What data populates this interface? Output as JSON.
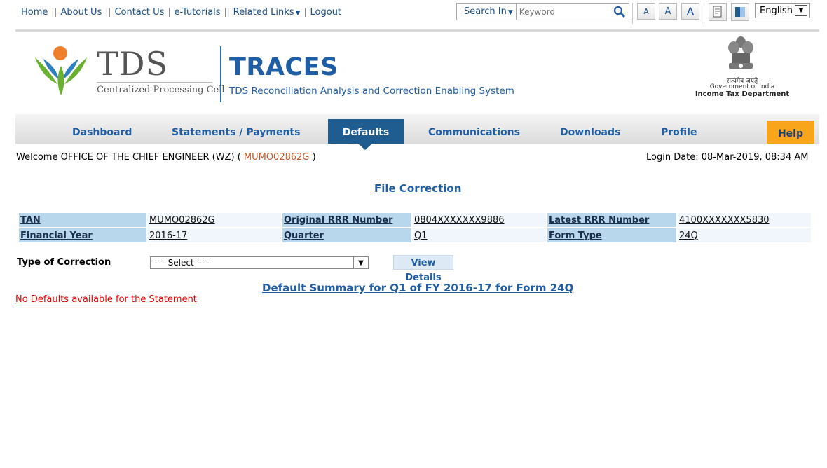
{
  "topbar": {
    "links": [
      "Home",
      "About Us",
      "Contact Us",
      "e-Tutorials",
      "Related Links",
      "Logout"
    ],
    "search_in_label": "Search In",
    "search_placeholder": "Keyword",
    "font_sizes": [
      "A",
      "A",
      "A"
    ],
    "language": "English"
  },
  "header": {
    "tds_logo_text": "TDS",
    "tds_subtitle": "Centralized Processing Cell",
    "app_name": "TRACES",
    "app_fullname": "TDS Reconciliation Analysis and Correction Enabling System",
    "gov_motto": "सत्यमेव जयते",
    "gov_line": "Government of India",
    "dept": "Income Tax Department"
  },
  "nav": {
    "items": [
      "Dashboard",
      "Statements / Payments",
      "Defaults",
      "Communications",
      "Downloads",
      "Profile"
    ],
    "active": "Defaults",
    "help": "Help"
  },
  "welcome": {
    "prefix": "Welcome OFFICE OF THE CHIEF ENGINEER (WZ) (",
    "tan": "MUMO02862G",
    "suffix": ")",
    "login_date": "Login Date: 08-Mar-2019, 08:34 AM"
  },
  "page": {
    "title": "File Correction",
    "info": {
      "tan_label": "TAN",
      "tan": "MUMO02862G",
      "orig_rrr_label": "Original RRR Number",
      "orig_rrr": "0804XXXXXXX9886",
      "latest_rrr_label": "Latest RRR Number",
      "latest_rrr": "4100XXXXXXX5830",
      "fy_label": "Financial Year",
      "fy": "2016-17",
      "quarter_label": "Quarter",
      "quarter": "Q1",
      "form_label": "Form Type",
      "form": "24Q"
    },
    "correction_label": "Type of Correction",
    "correction_selected": "-----Select-----",
    "view_details": "View Details",
    "summary_title": "Default Summary for Q1 of FY 2016-17 for Form 24Q",
    "no_defaults": "No Defaults available for the Statement"
  },
  "colors": {
    "link_blue": "#1f5da5",
    "nav_active": "#1f5c8f",
    "help_orange": "#f8a51b",
    "label_bg": "#b8d6ec",
    "error_red": "#e00000"
  }
}
